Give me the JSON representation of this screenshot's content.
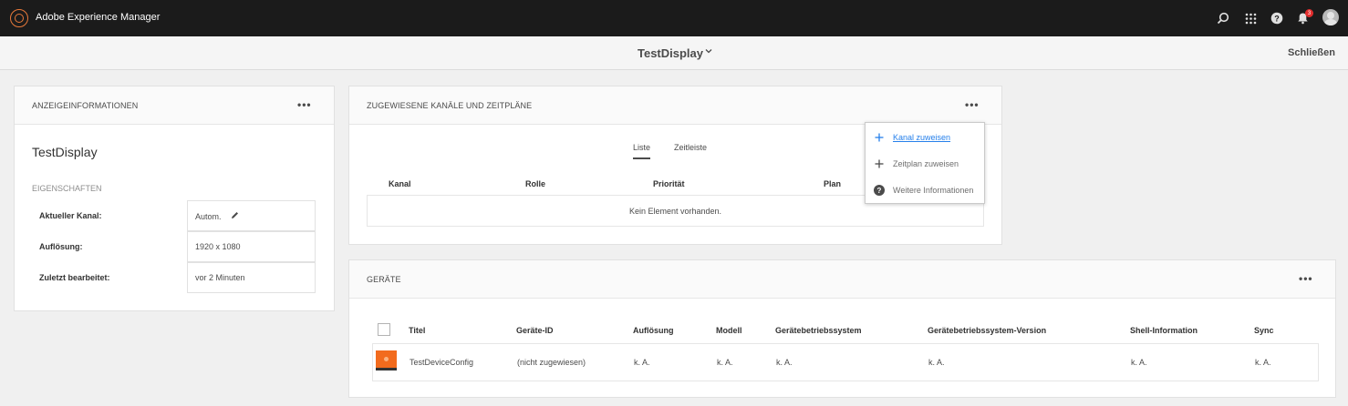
{
  "shell": {
    "app_title": "Adobe Experience Manager",
    "notification_count": "3",
    "icons": [
      "search-icon",
      "apps-grid-icon",
      "help-icon",
      "bell-icon",
      "user-avatar"
    ]
  },
  "titlebar": {
    "title": "TestDisplay",
    "chevron": "⌄",
    "close_label": "Schließen"
  },
  "display_info": {
    "card_title": "ANZEIGEINFORMATIONEN",
    "more": "•••",
    "name": "TestDisplay",
    "properties_label": "EIGENSCHAFTEN",
    "properties": [
      {
        "label": "Aktueller Kanal:",
        "value": "Autom."
      },
      {
        "label": "Auflösung:",
        "value": "1920 x 1080"
      },
      {
        "label": "Zuletzt bearbeitet:",
        "value": "vor 2 Minuten"
      }
    ]
  },
  "channels": {
    "card_title": "ZUGEWIESENE KANÄLE UND ZEITPLÄNE",
    "more": "•••",
    "tabs": [
      {
        "label": "Liste",
        "active": true
      },
      {
        "label": "Zeitleiste",
        "active": false
      }
    ],
    "columns": [
      "Kanal",
      "Rolle",
      "Priorität",
      "Plan"
    ],
    "empty_text": "Kein Element vorhanden."
  },
  "popover": {
    "items": [
      {
        "label": "Kanal zuweisen",
        "icon": "plus-icon"
      },
      {
        "label": "Zeitplan zuweisen",
        "icon": "plus-icon"
      },
      {
        "label": "Weitere Informationen",
        "icon": "help-icon"
      }
    ]
  },
  "devices": {
    "card_title": "GERÄTE",
    "more": "•••",
    "columns": [
      "Titel",
      "Geräte-ID",
      "Auflösung",
      "Modell",
      "Gerätebetriebssystem",
      "Gerätebetriebssystem-Version",
      "Shell-Information",
      "Sync"
    ],
    "rows": [
      {
        "title": "TestDeviceConfig",
        "device_id": "(nicht zugewiesen)",
        "resolution": "k. A.",
        "model": "k. A.",
        "os": "k. A.",
        "os_version": "k. A.",
        "shell_info": "k. A.",
        "sync": "k. A."
      }
    ]
  },
  "colors": {
    "shell_bg": "#1b1b1b",
    "brand_orange": "#e8793a",
    "link_blue": "#2680eb",
    "badge_red": "#e32d2d"
  }
}
